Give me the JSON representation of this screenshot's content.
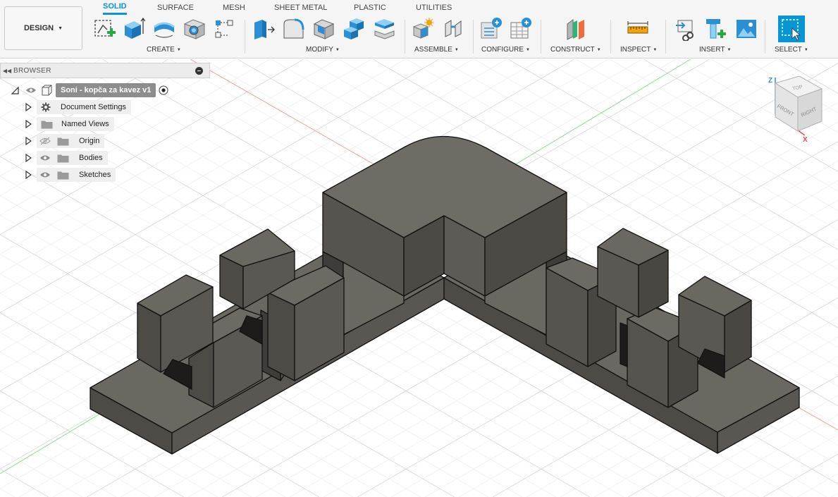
{
  "workspace": {
    "label": "DESIGN"
  },
  "tabs": [
    {
      "label": "SOLID",
      "active": true
    },
    {
      "label": "SURFACE",
      "active": false
    },
    {
      "label": "MESH",
      "active": false
    },
    {
      "label": "SHEET METAL",
      "active": false
    },
    {
      "label": "PLASTIC",
      "active": false
    },
    {
      "label": "UTILITIES",
      "active": false
    }
  ],
  "groups": {
    "create": "CREATE",
    "modify": "MODIFY",
    "assemble": "ASSEMBLE",
    "configure": "CONFIGURE",
    "construct": "CONSTRUCT",
    "inspect": "INSPECT",
    "insert": "INSERT",
    "select": "SELECT"
  },
  "icons": {
    "create": [
      "create-sketch-icon",
      "extrude-icon",
      "revolve-icon",
      "hole-icon",
      "pattern-icon"
    ],
    "modify": [
      "press-pull-icon",
      "fillet-icon",
      "shell-icon",
      "combine-icon",
      "offset-face-icon"
    ],
    "assemble": [
      "new-component-icon",
      "joint-icon"
    ],
    "configure": [
      "configure-icon",
      "table-icon"
    ],
    "construct": "offset-plane-icon",
    "inspect": "measure-icon",
    "insert": [
      "insert-derive-icon",
      "insert-mcmaster-icon",
      "insert-canvas-icon"
    ],
    "select": "select-icon"
  },
  "browser": {
    "title": "BROWSER",
    "root": "Soni - kopča za kavez v1",
    "items": [
      {
        "label": "Document Settings",
        "icon": "gear-icon"
      },
      {
        "label": "Named Views",
        "icon": "folder-icon"
      },
      {
        "label": "Origin",
        "icon": "folder-icon",
        "visible": false
      },
      {
        "label": "Bodies",
        "icon": "folder-icon",
        "visible": true
      },
      {
        "label": "Sketches",
        "icon": "folder-icon",
        "visible": true
      }
    ]
  },
  "viewcube": {
    "top": "TOP",
    "front": "FRONT",
    "right": "RIGHT",
    "axis_z": "Z",
    "axis_x": "X"
  },
  "colors": {
    "accent": "#0696d7",
    "body_top": "#6e6b65",
    "body_side": "#5b5853"
  }
}
